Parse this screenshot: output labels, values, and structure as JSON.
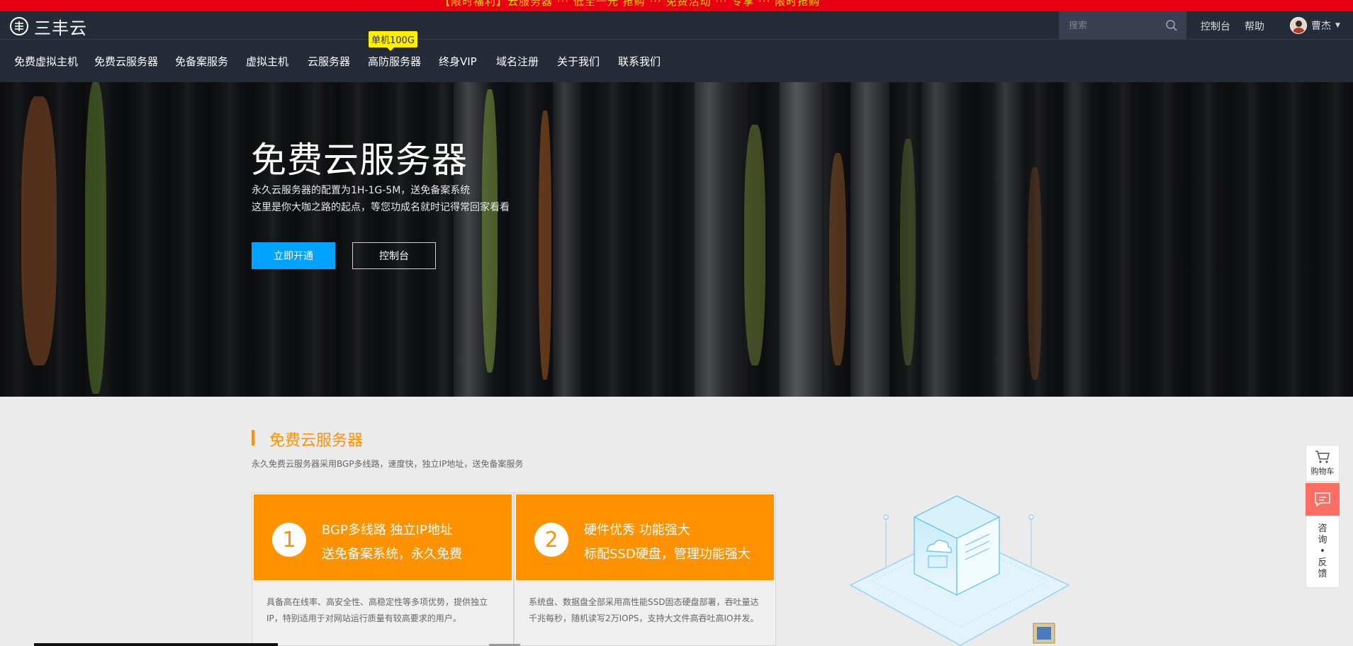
{
  "promo": {
    "text": "【限时福利】云服务器 ··· 低至一元 抢购 ··· 免费活动 ··· 专享 ··· 限时抢购"
  },
  "header": {
    "logo_text": "三丰云",
    "search_placeholder": "搜索",
    "links": {
      "console": "控制台",
      "help": "帮助"
    },
    "user_name": "曹杰",
    "nav": [
      "免费虚拟主机",
      "免费云服务器",
      "免备案服务",
      "虚拟主机",
      "云服务器",
      "高防服务器",
      "终身VIP",
      "域名注册",
      "关于我们",
      "联系我们"
    ],
    "nav_badge": "单机100G"
  },
  "hero": {
    "title": "免费云服务器",
    "line1": "永久云服务器的配置为1H-1G-5M，送免备案系统",
    "line2": "这里是你大咖之路的起点，等您功成名就时记得常回家看看",
    "btn_primary": "立即开通",
    "btn_secondary": "控制台"
  },
  "section": {
    "title": "免费云服务器",
    "subtitle": "永久免费云服务器采用BGP多线路，速度快，独立IP地址，送免备案服务",
    "cards": [
      {
        "num": "1",
        "line1": "BGP多线路   独立IP地址",
        "line2": "送免备案系统，永久免费",
        "desc": "具备高在线率、高安全性、高稳定性等多项优势，提供独立IP，特别适用于对网站运行质量有较高要求的用户。"
      },
      {
        "num": "2",
        "line1": "硬件优秀   功能强大",
        "line2": "标配SSD硬盘，管理功能强大",
        "desc": "系统盘、数据盘全部采用高性能SSD固态硬盘部署，吞吐量达千兆每秒，随机读写2万IOPS，支持大文件高吞吐高IO并发。"
      }
    ]
  },
  "float": {
    "cart": "购物车",
    "feedback": [
      "咨",
      "询",
      "•",
      "反",
      "馈"
    ]
  },
  "colors": {
    "promo_red": "#e60012",
    "header_bg": "#262b38",
    "accent_orange": "#ff9200",
    "primary_blue": "#00a3ff",
    "chat_red": "#ff6e62"
  }
}
